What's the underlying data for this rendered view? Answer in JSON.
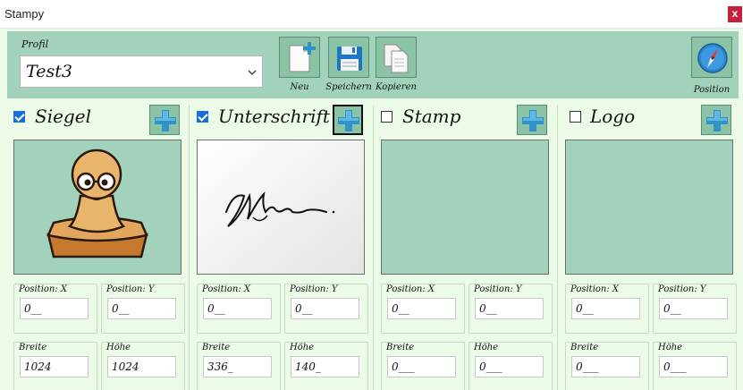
{
  "window": {
    "title": "Stampy",
    "close_symbol": "x"
  },
  "profile": {
    "label": "Profil",
    "value": "Test3"
  },
  "toolbar": {
    "new_label": "Neu",
    "save_label": "Speichern",
    "copy_label": "Kopieren",
    "position_label": "Position"
  },
  "columns": [
    {
      "title": "Siegel",
      "checked": true,
      "pos_x_label": "Position: X",
      "pos_x": "0__",
      "pos_y_label": "Position: Y",
      "pos_y": "0__",
      "width_label": "Breite",
      "width": "1024",
      "height_label": "Höhe",
      "height": "1024"
    },
    {
      "title": "Unterschrift",
      "checked": true,
      "pos_x_label": "Position: X",
      "pos_x": "0__",
      "pos_y_label": "Position: Y",
      "pos_y": "0__",
      "width_label": "Breite",
      "width": "336_",
      "height_label": "Höhe",
      "height": "140_"
    },
    {
      "title": "Stamp",
      "checked": false,
      "pos_x_label": "Position: X",
      "pos_x": "0__",
      "pos_y_label": "Position: Y",
      "pos_y": "0__",
      "width_label": "Breite",
      "width": "0___",
      "height_label": "Höhe",
      "height": "0___"
    },
    {
      "title": "Logo",
      "checked": false,
      "pos_x_label": "Position: X",
      "pos_x": "0__",
      "pos_y_label": "Position: Y",
      "pos_y": "0__",
      "width_label": "Breite",
      "width": "0___",
      "height_label": "Höhe",
      "height": "0___"
    }
  ],
  "colors": {
    "panel": "#a2d2bb",
    "background": "#ecfbe8",
    "button": "#8cc2a6",
    "plus": "#2f93c9",
    "checkbox": "#1a6ed8"
  }
}
